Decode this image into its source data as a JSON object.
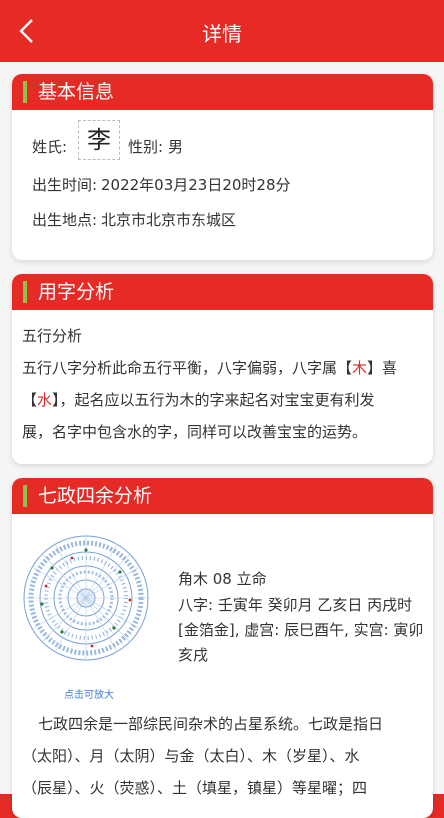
{
  "header": {
    "title": "详情"
  },
  "basic_info": {
    "title": "基本信息",
    "surname_label": "姓氏:",
    "surname_value": "李",
    "gender_label": "性别:",
    "gender_value": "男",
    "birth_time_label": "出生时间:",
    "birth_time_value": "2022年03月23日20时28分",
    "birth_place_label": "出生地点:",
    "birth_place_value": "北京市北京市东城区"
  },
  "usage_analysis": {
    "title": "用字分析",
    "subtitle": "五行分析",
    "p1": "五行八字分析此命五行平衡，八字偏弱，八字属【",
    "wood": "木",
    "p2": "】喜",
    "p3": "【",
    "water": "水",
    "p4": "】，起名应以五行为木的字来起名对宝宝更有利发",
    "p5": "展，名字中包含水的字，同样可以改善宝宝的运势。"
  },
  "qizheng_analysis": {
    "title": "七政四余分析",
    "chart_caption": "点击可放大",
    "line1": "角木 08 立命",
    "line2": "八字: 壬寅年 癸卯月 乙亥日 丙戌时",
    "line3": "[金箔金], 虚宫: 辰巳酉午, 实宫: 寅卯",
    "line4": "亥戌",
    "desc1": "七政四余是一部综民间杂术的占星系统。七政是指日",
    "desc2": "（太阳）、月（太阴）与金（太白）、木（岁星）、水",
    "desc3": "（辰星）、火（荧惑）、土（填星，镇星）等星曜；四"
  },
  "colors": {
    "brand_red": "#e62b26",
    "accent_green": "#8bc34a",
    "link_blue": "#3f7be0"
  }
}
